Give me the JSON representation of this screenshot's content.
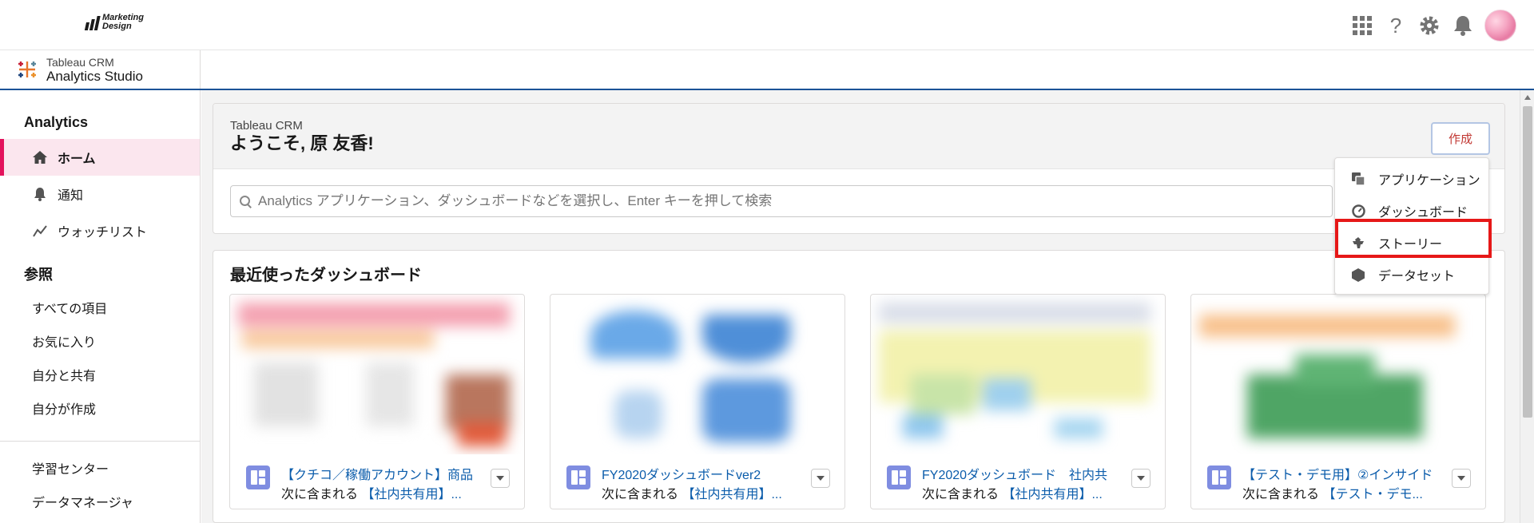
{
  "brand": {
    "logo_line1": "Marketing",
    "logo_line2": "Design"
  },
  "global_header": {
    "help_glyph": "?"
  },
  "app": {
    "sub_title": "Tableau CRM",
    "title": "Analytics Studio"
  },
  "sidebar": {
    "section_analytics": "Analytics",
    "items": [
      {
        "label": "ホーム",
        "icon": "home-icon"
      },
      {
        "label": "通知",
        "icon": "bell-icon"
      },
      {
        "label": "ウォッチリスト",
        "icon": "watchlist-icon"
      }
    ],
    "section_browse": "参照",
    "browse": [
      "すべての項目",
      "お気に入り",
      "自分と共有",
      "自分が作成"
    ],
    "extra": [
      "学習センター",
      "データマネージャ"
    ]
  },
  "welcome": {
    "sub_title": "Tableau CRM",
    "title": "ようこそ, 原 友香!",
    "create_label": "作成",
    "search_placeholder": "Analytics アプリケーション、ダッシュボードなどを選択し、Enter キーを押して検索"
  },
  "recent": {
    "title": "最近使ったダッシュボード",
    "included_in": "次に含まれる",
    "tiles": [
      {
        "name": "【クチコ／稼働アカウント】商品",
        "app": "【社内共有用】..."
      },
      {
        "name": "FY2020ダッシュボードver2",
        "app": "【社内共有用】..."
      },
      {
        "name": "FY2020ダッシュボード　社内共",
        "app": "【社内共有用】..."
      },
      {
        "name": "【テスト・デモ用】②インサイド",
        "app": "【テスト・デモ..."
      }
    ]
  },
  "create_menu": {
    "items": [
      {
        "label": "アプリケーション",
        "icon": "app-icon"
      },
      {
        "label": "ダッシュボード",
        "icon": "dashboard-icon"
      },
      {
        "label": "ストーリー",
        "icon": "story-icon"
      },
      {
        "label": "データセット",
        "icon": "dataset-icon"
      }
    ],
    "highlight_color": "#e61818"
  },
  "colors": {
    "accent": "#e3125c",
    "link": "#0b5cab",
    "app_bar_border": "#1b5297"
  }
}
